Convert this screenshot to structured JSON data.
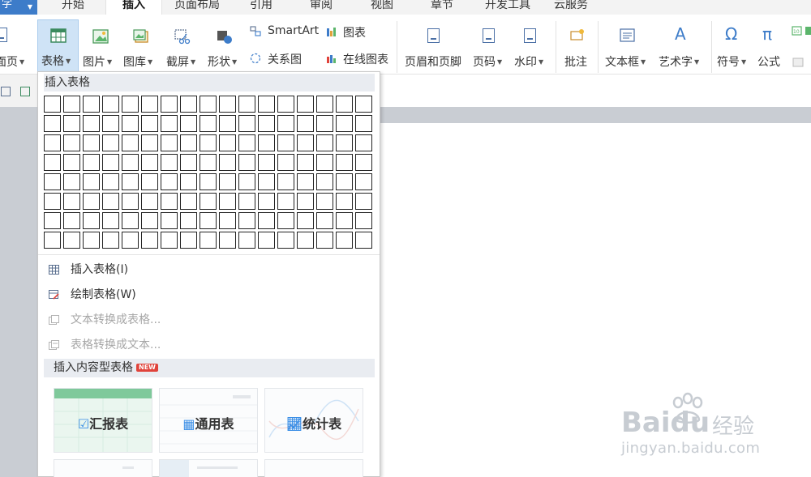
{
  "app": {
    "button_label": "字"
  },
  "tabs": [
    {
      "label": "开始"
    },
    {
      "label": "插入"
    },
    {
      "label": "页面布局"
    },
    {
      "label": "引用"
    },
    {
      "label": "审阅"
    },
    {
      "label": "视图"
    },
    {
      "label": "章节"
    },
    {
      "label": "开发工具"
    },
    {
      "label": "云服务"
    }
  ],
  "ribbon": {
    "page_label": "面页",
    "table_label": "表格",
    "picture_label": "图片",
    "gallery_label": "图库",
    "screenshot_label": "截屏",
    "shape_label": "形状",
    "smartart_label": "SmartArt",
    "chart_label": "图表",
    "relation_label": "关系图",
    "online_chart_label": "在线图表",
    "header_footer_label": "页眉和页脚",
    "page_number_label": "页码",
    "watermark_label": "水印",
    "comment_label": "批注",
    "textbox_label": "文本框",
    "wordart_label": "艺术字",
    "symbol_label": "符号",
    "formula_label": "公式",
    "symbol_glyph": "Ω",
    "formula_glyph": "π",
    "wordart_glyph": "A"
  },
  "dropdown": {
    "insert_table_header": "插入表格",
    "grid": {
      "columns": 17,
      "rows": 8
    },
    "menu_items": [
      {
        "label": "插入表格(I)",
        "enabled": true,
        "icon": "table-icon"
      },
      {
        "label": "绘制表格(W)",
        "enabled": true,
        "icon": "draw-table-icon"
      },
      {
        "label": "文本转换成表格...",
        "enabled": false,
        "icon": "text-to-table-icon"
      },
      {
        "label": "表格转换成文本...",
        "enabled": false,
        "icon": "table-to-text-icon"
      }
    ],
    "content_table_header": "插入内容型表格",
    "new_badge": "NEW",
    "cards": [
      {
        "label": "汇报表",
        "icon": "report-icon"
      },
      {
        "label": "通用表",
        "icon": "grid-icon"
      },
      {
        "label": "统计表",
        "icon": "stats-icon"
      }
    ]
  },
  "watermark": {
    "brand": "Baidu",
    "product": "经验",
    "url": "jingyan.baidu.com"
  },
  "colors": {
    "accent": "#3d7cc9",
    "active_button_bg": "#cfe3f6",
    "badge": "#e0433b",
    "workspace": "#c9cdd3",
    "card_icon": "#3a8ee6"
  }
}
